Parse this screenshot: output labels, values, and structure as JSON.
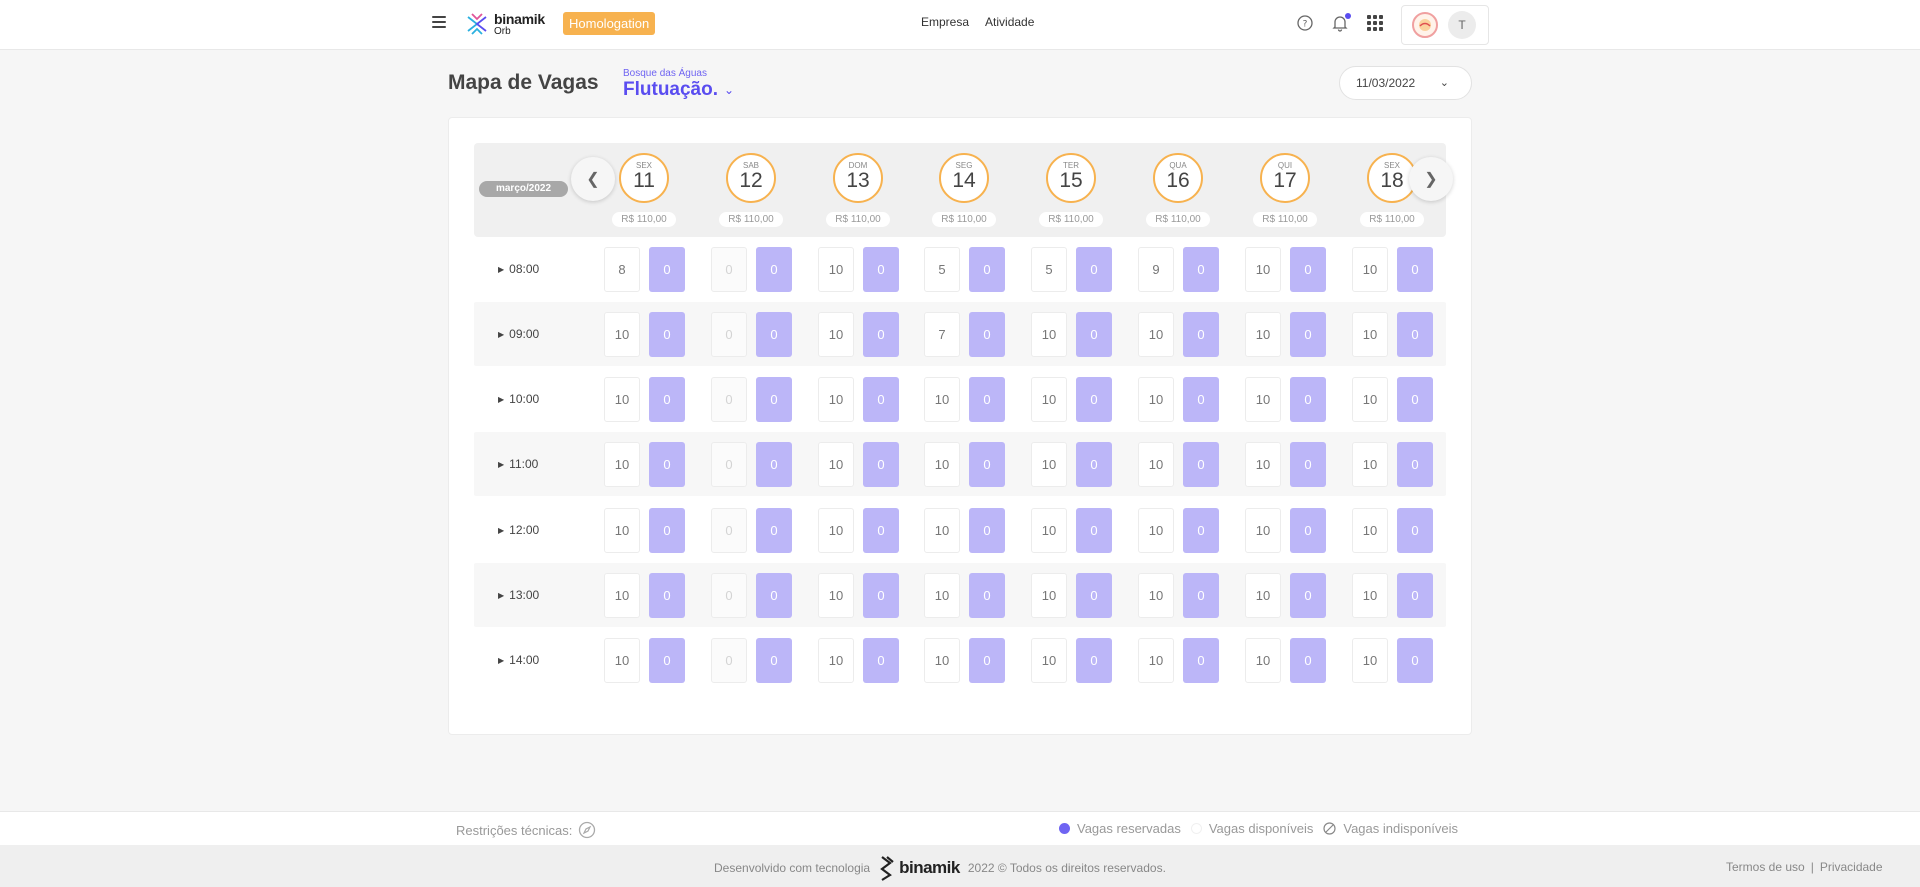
{
  "header": {
    "brand_name": "binamik",
    "brand_sub": "Orb",
    "env_badge": "Homologation",
    "nav": [
      "Empresa",
      "Atividade"
    ],
    "user_initial": "T",
    "accent_color": "#5a4df0",
    "badge_color": "#f7b24f"
  },
  "page": {
    "title": "Mapa de Vagas",
    "place_sub": "Bosque das Águas",
    "place_name": "Flutuação.",
    "selected_date": "11/03/2022"
  },
  "calendar": {
    "month": "março/2022",
    "days": [
      {
        "weekday": "SEX",
        "day": "11",
        "price": "R$ 110,00"
      },
      {
        "weekday": "SAB",
        "day": "12",
        "price": "R$ 110,00"
      },
      {
        "weekday": "DOM",
        "day": "13",
        "price": "R$ 110,00"
      },
      {
        "weekday": "SEG",
        "day": "14",
        "price": "R$ 110,00"
      },
      {
        "weekday": "TER",
        "day": "15",
        "price": "R$ 110,00"
      },
      {
        "weekday": "QUA",
        "day": "16",
        "price": "R$ 110,00"
      },
      {
        "weekday": "QUI",
        "day": "17",
        "price": "R$ 110,00"
      },
      {
        "weekday": "SEX",
        "day": "18",
        "price": "R$ 110,00"
      }
    ],
    "rows": [
      {
        "time": "08:00",
        "available": [
          "8",
          "0",
          "10",
          "5",
          "5",
          "9",
          "10",
          "10"
        ],
        "reserved": [
          "0",
          "0",
          "0",
          "0",
          "0",
          "0",
          "0",
          "0"
        ]
      },
      {
        "time": "09:00",
        "available": [
          "10",
          "0",
          "10",
          "7",
          "10",
          "10",
          "10",
          "10"
        ],
        "reserved": [
          "0",
          "0",
          "0",
          "0",
          "0",
          "0",
          "0",
          "0"
        ]
      },
      {
        "time": "10:00",
        "available": [
          "10",
          "0",
          "10",
          "10",
          "10",
          "10",
          "10",
          "10"
        ],
        "reserved": [
          "0",
          "0",
          "0",
          "0",
          "0",
          "0",
          "0",
          "0"
        ]
      },
      {
        "time": "11:00",
        "available": [
          "10",
          "0",
          "10",
          "10",
          "10",
          "10",
          "10",
          "10"
        ],
        "reserved": [
          "0",
          "0",
          "0",
          "0",
          "0",
          "0",
          "0",
          "0"
        ]
      },
      {
        "time": "12:00",
        "available": [
          "10",
          "0",
          "10",
          "10",
          "10",
          "10",
          "10",
          "10"
        ],
        "reserved": [
          "0",
          "0",
          "0",
          "0",
          "0",
          "0",
          "0",
          "0"
        ]
      },
      {
        "time": "13:00",
        "available": [
          "10",
          "0",
          "10",
          "10",
          "10",
          "10",
          "10",
          "10"
        ],
        "reserved": [
          "0",
          "0",
          "0",
          "0",
          "0",
          "0",
          "0",
          "0"
        ]
      },
      {
        "time": "14:00",
        "available": [
          "10",
          "0",
          "10",
          "10",
          "10",
          "10",
          "10",
          "10"
        ],
        "reserved": [
          "0",
          "0",
          "0",
          "0",
          "0",
          "0",
          "0",
          "0"
        ]
      }
    ]
  },
  "legend": {
    "restrictions_label": "Restrições técnicas:",
    "reserved": "Vagas reservadas",
    "available": "Vagas disponíveis",
    "unavailable": "Vagas indisponíveis",
    "reserved_color": "#6f64f2"
  },
  "footer": {
    "developed_with": "Desenvolvido com tecnologia",
    "logo": "binamik",
    "copyright": "2022 © Todos os direitos reservados.",
    "terms": "Termos de uso",
    "separator": "|",
    "privacy": "Privacidade"
  }
}
